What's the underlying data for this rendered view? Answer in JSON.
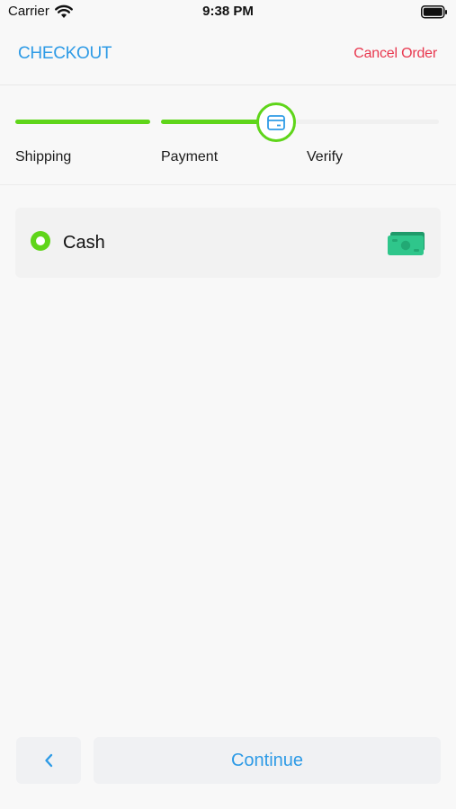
{
  "status_bar": {
    "carrier": "Carrier",
    "time": "9:38 PM"
  },
  "header": {
    "title": "CHECKOUT",
    "cancel_label": "Cancel Order"
  },
  "stepper": {
    "steps": [
      {
        "label": "Shipping",
        "state": "completed"
      },
      {
        "label": "Payment",
        "state": "active"
      },
      {
        "label": "Verify",
        "state": "pending"
      }
    ],
    "active_icon": "card-icon"
  },
  "payment_methods": [
    {
      "label": "Cash",
      "selected": true,
      "icon": "cash-icon"
    }
  ],
  "footer": {
    "back_icon": "chevron-left-icon",
    "continue_label": "Continue"
  },
  "colors": {
    "accent_blue": "#2e9be6",
    "accent_green": "#5fd51a",
    "danger_red": "#e8384f",
    "background": "#f8f8f8"
  }
}
